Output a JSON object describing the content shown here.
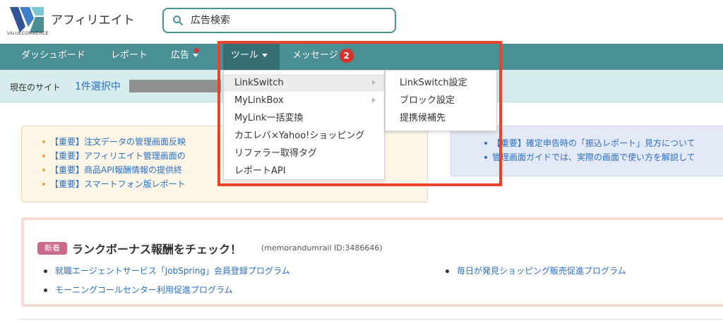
{
  "header": {
    "brand": "アフィリエイト",
    "logo_text": "VALUECOMMERCE",
    "search": {
      "placeholder": "広告検索",
      "value": ""
    }
  },
  "nav": {
    "items": [
      {
        "label": "ダッシュボード"
      },
      {
        "label": "レポート"
      },
      {
        "label": "広告"
      },
      {
        "label": "ツール"
      },
      {
        "label": "メッセージ",
        "badge": "2"
      }
    ]
  },
  "site_bar": {
    "label": "現在のサイト",
    "selected": "1件選択中"
  },
  "notices_left": [
    "【重要】注文データの管理画面反映",
    "【重要】アフィリエイト管理画面の",
    "【重要】商品API報酬情報の提供終",
    "【重要】スマートフォン版レポート"
  ],
  "notices_right": [
    "【重要】確定申告時の「振込レポート」見方について",
    "管理画面ガイドでは、実際の画面で使い方を解説して"
  ],
  "campaign": {
    "tag": "新着",
    "title": "ランクボーナス報酬をチェック！",
    "id_text": "(memorandumrail ID:3486646)",
    "links": [
      "就職エージェントサービス「JobSpring」会員登録プログラム",
      "毎日が発見ショッピング販売促進プログラム",
      "モーニングコールセンター利用促進プログラム"
    ]
  },
  "tools_menu": [
    {
      "label": "LinkSwitch",
      "has_submenu": true
    },
    {
      "label": "MyLinkBox",
      "has_submenu": true
    },
    {
      "label": "MyLink一括変換"
    },
    {
      "label": "カエレバ×Yahoo!ショッピング"
    },
    {
      "label": "リファラー取得タグ"
    },
    {
      "label": "レポートAPI"
    }
  ],
  "linkswitch_submenu": [
    {
      "label": "LinkSwitch設定"
    },
    {
      "label": "ブロック設定"
    },
    {
      "label": "提携候補先"
    }
  ],
  "colors": {
    "nav_bg": "#4a8f93",
    "nav_active": "#356f72",
    "link": "#2a6fc0",
    "badge": "#d9312a",
    "highlight": "#e8432d"
  }
}
